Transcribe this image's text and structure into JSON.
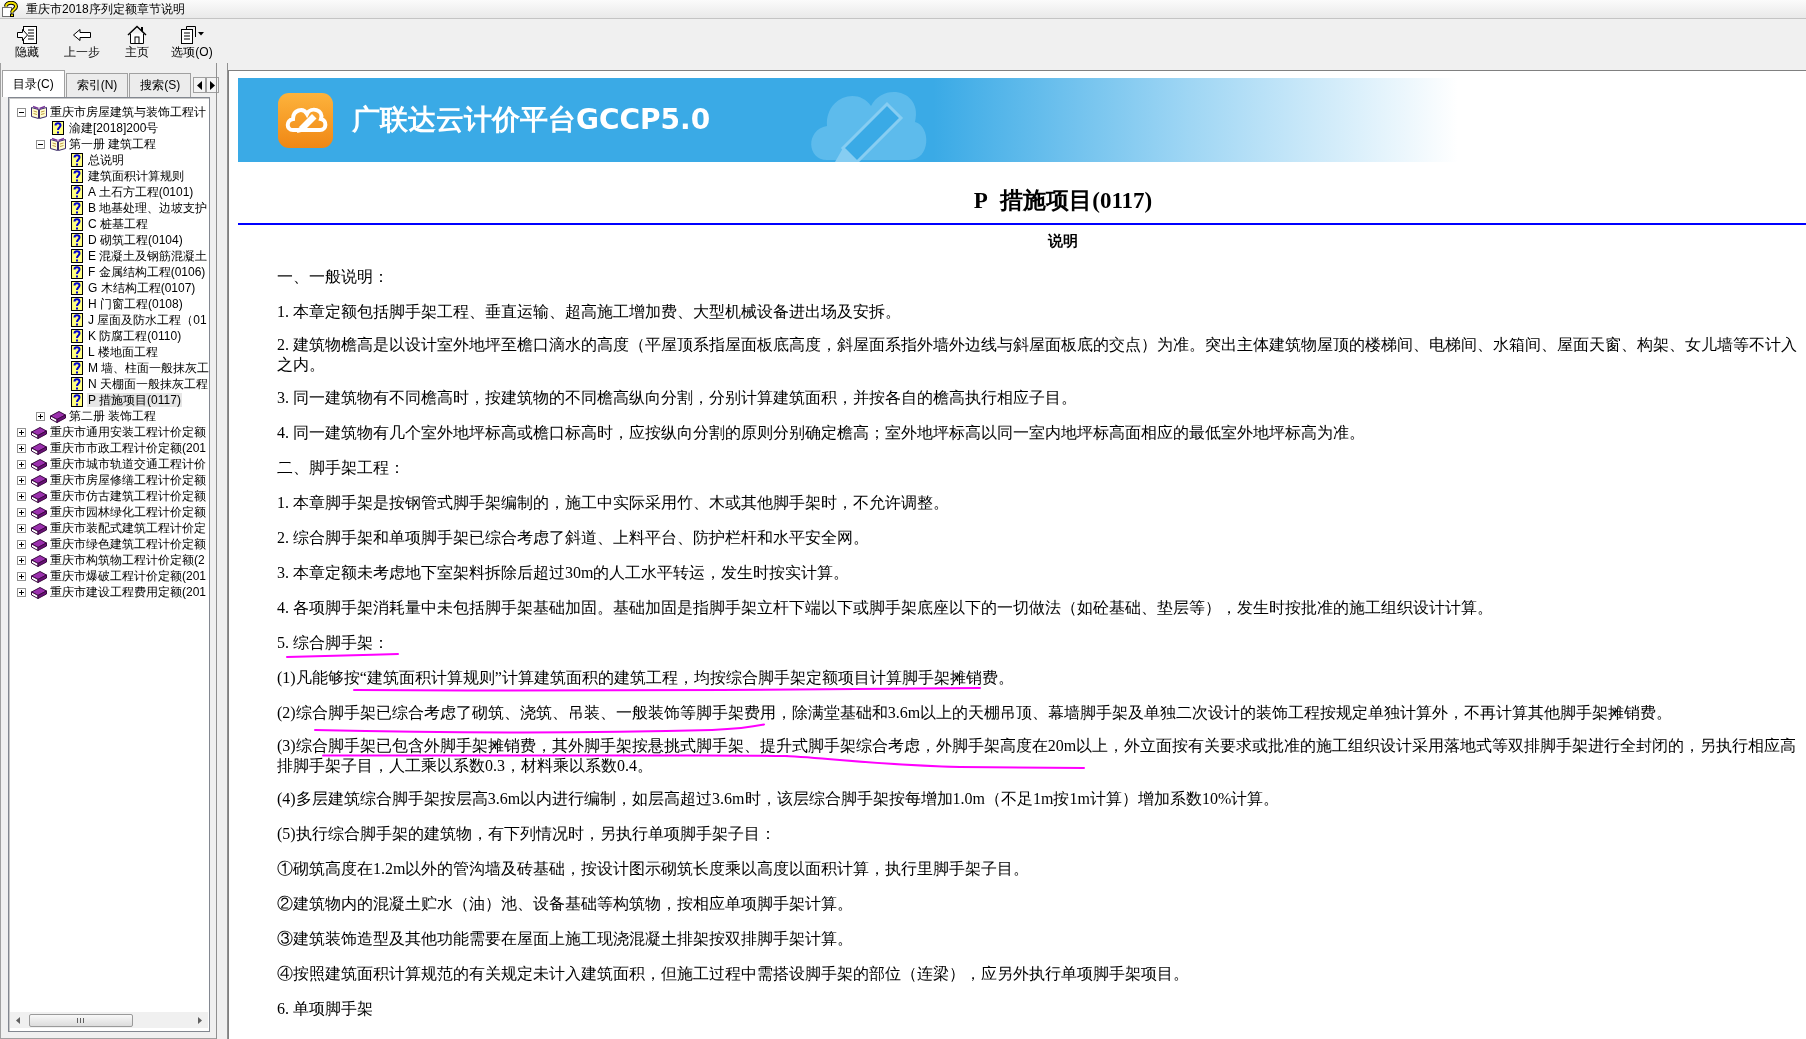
{
  "window": {
    "title": "重庆市2018序列定额章节说明"
  },
  "toolbar": [
    {
      "label": "隐藏"
    },
    {
      "label": "上一步"
    },
    {
      "label": "主页"
    },
    {
      "label": "选项(O)"
    }
  ],
  "sidebar": {
    "tabs": [
      {
        "label": "目录(C)",
        "selected": true
      },
      {
        "label": "索引(N)",
        "selected": false
      },
      {
        "label": "搜索(S)",
        "selected": false
      }
    ],
    "tree": [
      {
        "kind": "book",
        "label": "重庆市房屋建筑与装饰工程计",
        "expanded": true,
        "selected": false,
        "children": [
          {
            "kind": "page",
            "label": "渝建[2018]200号",
            "selected": false
          },
          {
            "kind": "book",
            "label": "第一册 建筑工程",
            "expanded": true,
            "selected": false,
            "children": [
              {
                "kind": "page",
                "label": "总说明",
                "selected": false
              },
              {
                "kind": "page",
                "label": "建筑面积计算规则",
                "selected": false
              },
              {
                "kind": "page",
                "label": "A 土石方工程(0101)",
                "selected": false
              },
              {
                "kind": "page",
                "label": "B 地基处理、边坡支护",
                "selected": false
              },
              {
                "kind": "page",
                "label": "C 桩基工程",
                "selected": false
              },
              {
                "kind": "page",
                "label": "D 砌筑工程(0104)",
                "selected": false
              },
              {
                "kind": "page",
                "label": "E 混凝土及钢筋混凝土",
                "selected": false
              },
              {
                "kind": "page",
                "label": "F 金属结构工程(0106)",
                "selected": false
              },
              {
                "kind": "page",
                "label": "G 木结构工程(0107)",
                "selected": false
              },
              {
                "kind": "page",
                "label": "H 门窗工程(0108)",
                "selected": false
              },
              {
                "kind": "page",
                "label": "J 屋面及防水工程（01",
                "selected": false
              },
              {
                "kind": "page",
                "label": "K 防腐工程(0110)",
                "selected": false
              },
              {
                "kind": "page",
                "label": "L 楼地面工程",
                "selected": false
              },
              {
                "kind": "page",
                "label": "M 墙、柱面一般抹灰工",
                "selected": false
              },
              {
                "kind": "page",
                "label": "N 天棚面一般抹灰工程",
                "selected": false
              },
              {
                "kind": "page",
                "label": "P 措施项目(0117)",
                "selected": true
              }
            ]
          },
          {
            "kind": "book",
            "label": "第二册 装饰工程",
            "expanded": false,
            "selected": false
          }
        ]
      },
      {
        "kind": "book",
        "label": "重庆市通用安装工程计价定额",
        "expanded": false,
        "selected": false
      },
      {
        "kind": "book",
        "label": "重庆市市政工程计价定额(201",
        "expanded": false,
        "selected": false
      },
      {
        "kind": "book",
        "label": "重庆市城市轨道交通工程计价",
        "expanded": false,
        "selected": false
      },
      {
        "kind": "book",
        "label": "重庆市房屋修缮工程计价定额",
        "expanded": false,
        "selected": false
      },
      {
        "kind": "book",
        "label": "重庆市仿古建筑工程计价定额",
        "expanded": false,
        "selected": false
      },
      {
        "kind": "book",
        "label": "重庆市园林绿化工程计价定额",
        "expanded": false,
        "selected": false
      },
      {
        "kind": "book",
        "label": "重庆市装配式建筑工程计价定",
        "expanded": false,
        "selected": false
      },
      {
        "kind": "book",
        "label": "重庆市绿色建筑工程计价定额",
        "expanded": false,
        "selected": false
      },
      {
        "kind": "book",
        "label": "重庆市构筑物工程计价定额(2",
        "expanded": false,
        "selected": false
      },
      {
        "kind": "book",
        "label": "重庆市爆破工程计价定额(201",
        "expanded": false,
        "selected": false
      },
      {
        "kind": "book",
        "label": "重庆市建设工程费用定额(201",
        "expanded": false,
        "selected": false
      }
    ]
  },
  "content": {
    "banner": {
      "title": "广联达云计价平台GCCP5.0"
    },
    "heading": "P 措施项目(0117)",
    "subheading": "说明",
    "paragraphs": [
      {
        "lines": [
          "一、一般说明："
        ]
      },
      {
        "lines": [
          "1. 本章定额包括脚手架工程、垂直运输、超高施工增加费、大型机械设备进出场及安拆。"
        ]
      },
      {
        "lines": [
          "2. 建筑物檐高是以设计室外地坪至檐口滴水的高度（平屋顶系指屋面板底高度，斜屋面系指外墙外边线与斜屋面板底的交点）为准。突出主体建筑物屋顶的楼梯间、电梯间、水箱间、屋面天窗、构架、女儿墙等不计入",
          "之内。"
        ]
      },
      {
        "lines": [
          "3. 同一建筑物有不同檐高时，按建筑物的不同檐高纵向分割，分别计算建筑面积，并按各自的檐高执行相应子目。"
        ]
      },
      {
        "lines": [
          "4. 同一建筑物有几个室外地坪标高或檐口标高时，应按纵向分割的原则分别确定檐高；室外地坪标高以同一室内地坪标高面相应的最低室外地坪标高为准。"
        ]
      },
      {
        "lines": [
          "二、脚手架工程："
        ]
      },
      {
        "lines": [
          "1. 本章脚手架是按钢管式脚手架编制的，施工中实际采用竹、木或其他脚手架时，不允许调整。"
        ]
      },
      {
        "lines": [
          "2. 综合脚手架和单项脚手架已综合考虑了斜道、上料平台、防护栏杆和水平安全网。"
        ]
      },
      {
        "lines": [
          "3. 本章定额未考虑地下室架料拆除后超过30m的人工水平转运，发生时按实计算。"
        ]
      },
      {
        "lines": [
          "4. 各项脚手架消耗量中未包括脚手架基础加固。基础加固是指脚手架立杆下端以下或脚手架底座以下的一切做法（如砼基础、垫层等），发生时按批准的施工组织设计计算。"
        ]
      },
      {
        "lines": [
          "5. 综合脚手架："
        ]
      },
      {
        "lines": [
          "(1)凡能够按“建筑面积计算规则”计算建筑面积的建筑工程，均按综合脚手架定额项目计算脚手架摊销费。"
        ]
      },
      {
        "lines": [
          "(2)综合脚手架已综合考虑了砌筑、浇筑、吊装、一般装饰等脚手架费用，除满堂基础和3.6m以上的天棚吊顶、幕墙脚手架及单独二次设计的装饰工程按规定单独计算外，不再计算其他脚手架摊销费。"
        ]
      },
      {
        "lines": [
          "(3)综合脚手架已包含外脚手架摊销费，其外脚手架按悬挑式脚手架、提升式脚手架综合考虑，外脚手架高度在20m以上，外立面按有关要求或批准的施工组织设计采用落地式等双排脚手架进行全封闭的，另执行相应高",
          "排脚手架子目，人工乘以系数0.3，材料乘以系数0.4。"
        ]
      },
      {
        "lines": [
          "(4)多层建筑综合脚手架按层高3.6m以内进行编制，如层高超过3.6m时，该层综合脚手架按每增加1.0m（不足1m按1m计算）增加系数10%计算。"
        ]
      },
      {
        "lines": [
          "(5)执行综合脚手架的建筑物，有下列情况时，另执行单项脚手架子目："
        ]
      },
      {
        "lines": [
          "①砌筑高度在1.2m以外的管沟墙及砖基础，按设计图示砌筑长度乘以高度以面积计算，执行里脚手架子目。"
        ]
      },
      {
        "lines": [
          "②建筑物内的混凝土贮水（油）池、设备基础等构筑物，按相应单项脚手架计算。"
        ]
      },
      {
        "lines": [
          "③建筑装饰造型及其他功能需要在屋面上施工现浇混凝土排架按双排脚手架计算。"
        ]
      },
      {
        "lines": [
          "④按照建筑面积计算规范的有关规定未计入建筑面积，但施工过程中需搭设脚手架的部位（连梁），应另外执行单项脚手架项目。"
        ]
      },
      {
        "lines": [
          "6. 单项脚手架"
        ]
      }
    ]
  }
}
